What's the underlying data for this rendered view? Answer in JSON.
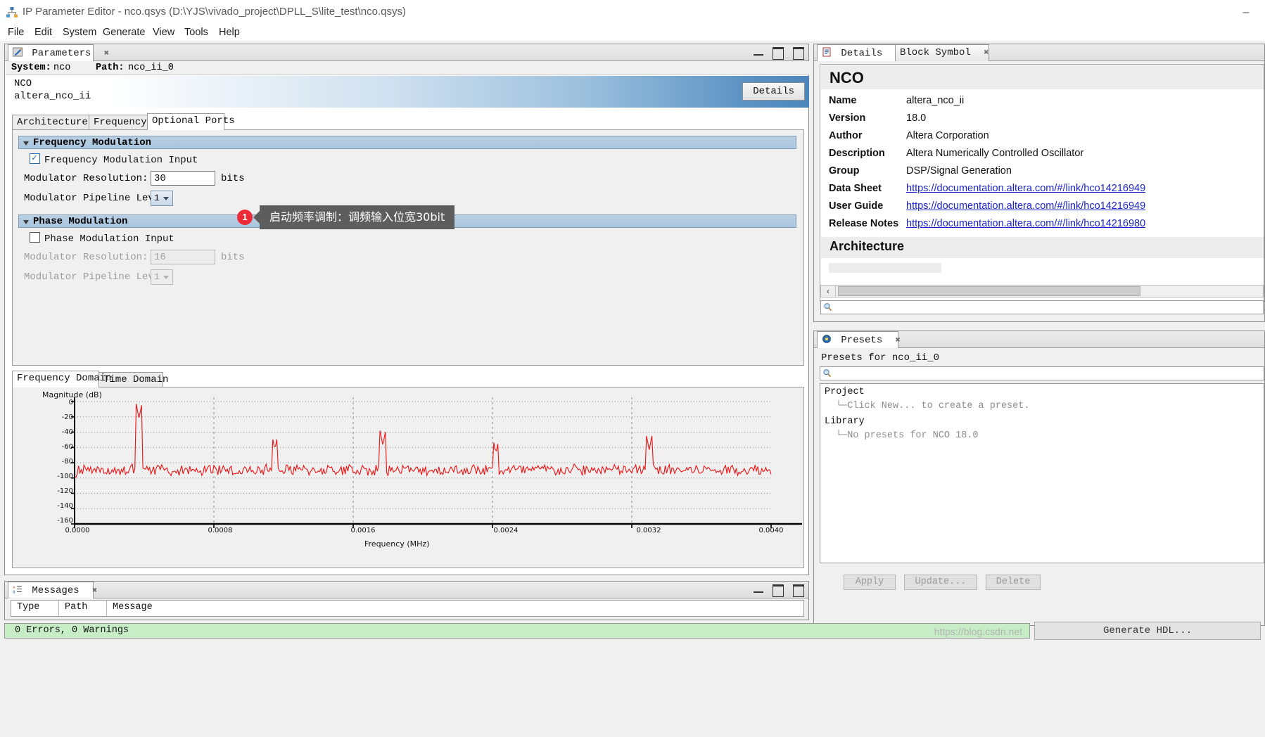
{
  "window": {
    "title": "IP Parameter Editor - nco.qsys (D:\\YJS\\vivado_project\\DPLL_S\\lite_test\\nco.qsys)",
    "minimize_label": "–",
    "app_icon": "sitemap-icon"
  },
  "menubar": {
    "items": [
      "File",
      "Edit",
      "System",
      "Generate",
      "View",
      "Tools",
      "Help"
    ]
  },
  "parameters_panel": {
    "tab_label": "Parameters",
    "tab_close": "✖",
    "system_key": "System:",
    "system_value": "nco",
    "path_key": "Path:",
    "path_value": "nco_ii_0",
    "ip_name": "NCO",
    "ip_module": "altera_nco_ii",
    "details_button": "Details",
    "tabs": [
      {
        "label": "Architecture",
        "selected": false
      },
      {
        "label": "Frequency",
        "selected": false
      },
      {
        "label": "Optional Ports",
        "selected": true
      }
    ],
    "groups": [
      {
        "title": "Frequency Modulation",
        "checkbox_label": "Frequency Modulation Input",
        "checkbox_checked": true,
        "resolution_label": "Modulator Resolution:",
        "resolution_value": "30",
        "resolution_unit": "bits",
        "pipeline_label": "Modulator Pipeline Level:",
        "pipeline_value": "1",
        "enabled": true
      },
      {
        "title": "Phase Modulation",
        "checkbox_label": "Phase Modulation Input",
        "checkbox_checked": false,
        "resolution_label": "Modulator Resolution:",
        "resolution_value": "16",
        "resolution_unit": "bits",
        "pipeline_label": "Modulator Pipeline Level:",
        "pipeline_value": "1",
        "enabled": false
      }
    ],
    "callout": {
      "number": "1",
      "text": "启动频率调制：调频输入位宽30bit"
    },
    "chart_tabs": [
      {
        "label": "Frequency Domain",
        "selected": true
      },
      {
        "label": "Time Domain",
        "selected": false
      }
    ]
  },
  "chart_data": {
    "type": "line",
    "title": "",
    "xlabel": "Frequency (MHz)",
    "ylabel": "Magnitude (dB)",
    "xlim": [
      0.0,
      0.004
    ],
    "ylim": [
      -160,
      0
    ],
    "grid": true,
    "legend": null,
    "series_color": "#ee1111",
    "xticks": [
      "0.0000",
      "0.0008",
      "0.0016",
      "0.0024",
      "0.0032",
      "0.0040"
    ],
    "xtick_values": [
      0.0,
      0.0008,
      0.0016,
      0.0024,
      0.0032,
      0.004
    ],
    "yticks": [
      "0",
      "-20",
      "-40",
      "-60",
      "-80",
      "-100",
      "-120",
      "-140",
      "-160"
    ],
    "ytick_values": [
      0,
      -20,
      -40,
      -60,
      -80,
      -100,
      -120,
      -140,
      -160
    ],
    "noise_floor_db": -88,
    "peaks": [
      {
        "x": 0.00037,
        "y": -22
      },
      {
        "x": 0.00115,
        "y": -63
      },
      {
        "x": 0.00177,
        "y": -57
      },
      {
        "x": 0.00242,
        "y": -68
      },
      {
        "x": 0.0033,
        "y": -63
      }
    ]
  },
  "details_panel": {
    "tabs": [
      {
        "label": "Details",
        "selected": true,
        "icon": "document-icon"
      },
      {
        "label": "Block Symbol",
        "selected": false,
        "icon": null
      }
    ],
    "tab_close": "✖",
    "heading": "NCO",
    "rows": [
      {
        "key": "Name",
        "value": "altera_nco_ii",
        "link": false
      },
      {
        "key": "Version",
        "value": "18.0",
        "link": false
      },
      {
        "key": "Author",
        "value": "Altera Corporation",
        "link": false
      },
      {
        "key": "Description",
        "value": "Altera Numerically Controlled Oscillator",
        "link": false
      },
      {
        "key": "Group",
        "value": "DSP/Signal Generation",
        "link": false
      },
      {
        "key": "Data Sheet",
        "value": "https://documentation.altera.com/#/link/hco14216949",
        "link": true
      },
      {
        "key": "User Guide",
        "value": "https://documentation.altera.com/#/link/hco14216949",
        "link": true
      },
      {
        "key": "Release Notes",
        "value": "https://documentation.altera.com/#/link/hco14216980",
        "link": true
      }
    ],
    "section_heading": "Architecture",
    "scroll_left_icon": "‹",
    "search_icon": "search-icon"
  },
  "presets_panel": {
    "tab_label": "Presets",
    "tab_close": "✖",
    "tab_icon": "presets-icon",
    "heading": "Presets for nco_ii_0",
    "search_icon": "search-icon",
    "tree": [
      {
        "text": "Project",
        "sub": false
      },
      {
        "text": "Click New... to create a preset.",
        "sub": true
      },
      {
        "text": "Library",
        "sub": false
      },
      {
        "text": "No presets for NCO 18.0",
        "sub": true
      }
    ],
    "buttons": [
      "Apply",
      "Update...",
      "Delete"
    ]
  },
  "messages_panel": {
    "tab_label": "Messages",
    "tab_close": "✖",
    "tab_icon": "messages-icon",
    "columns": [
      "Type",
      "Path",
      "Message"
    ]
  },
  "statusbar": {
    "text": "0 Errors, 0 Warnings",
    "watermark": "https://blog.csdn.net",
    "generate_button": "Generate HDL..."
  },
  "colors": {
    "accent_blue": "#4c86bb",
    "callout_red": "#ec2b36",
    "status_green": "#c6edc6",
    "trace_red": "#ee1111",
    "link_blue": "#1a23c8"
  }
}
